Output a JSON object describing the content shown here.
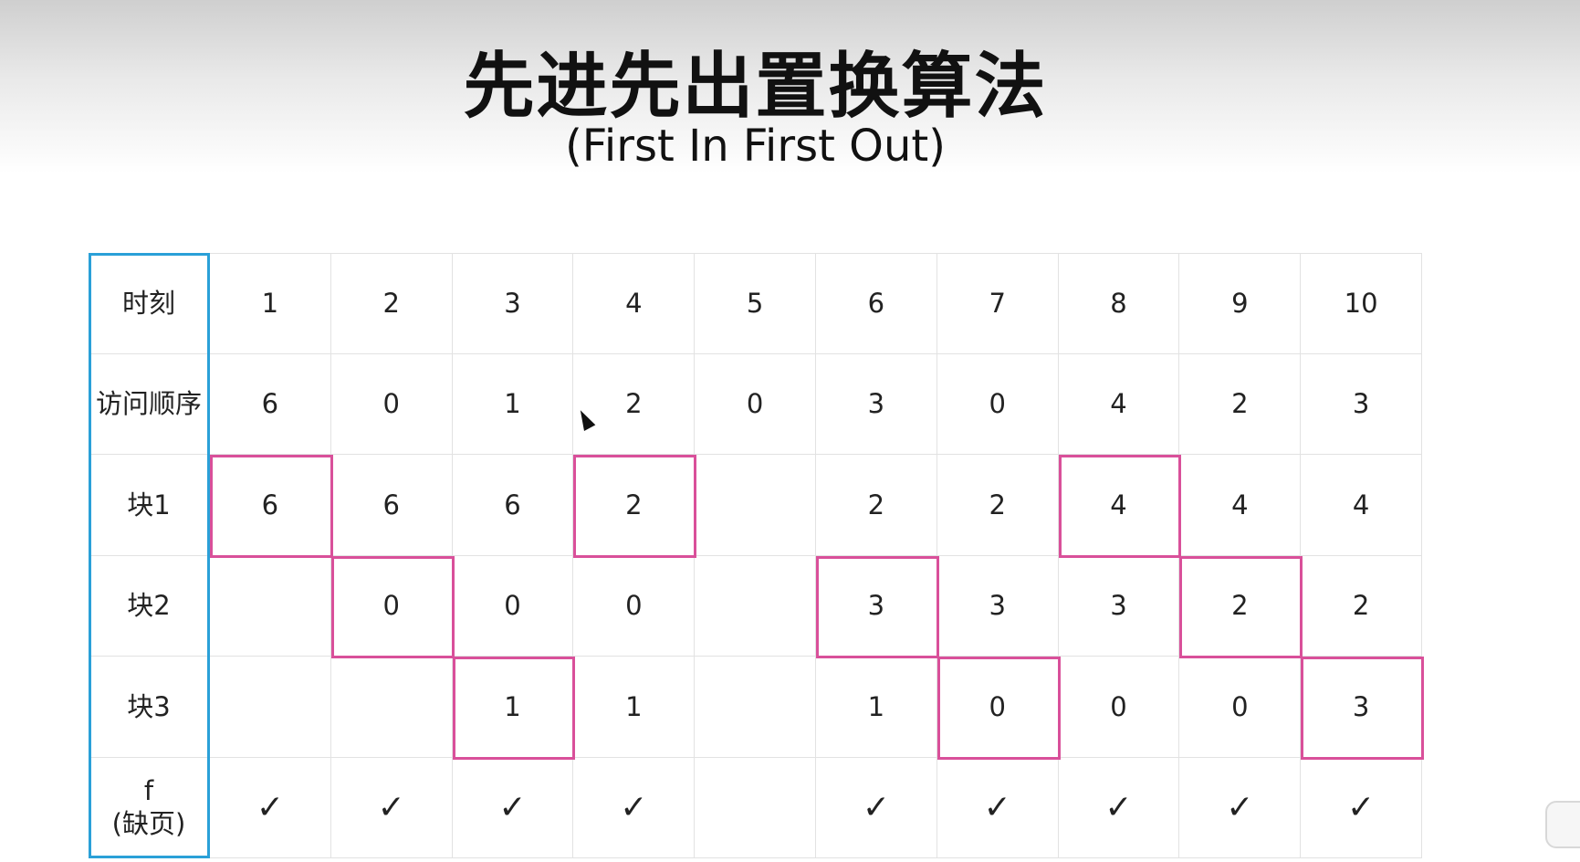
{
  "title": "先进先出置换算法",
  "subtitle": "(First In First Out)",
  "table": {
    "row_labels": [
      "时刻",
      "访问顺序",
      "块1",
      "块2",
      "块3",
      "f\n(缺页)"
    ],
    "times": [
      "1",
      "2",
      "3",
      "4",
      "5",
      "6",
      "7",
      "8",
      "9",
      "10"
    ],
    "access_sequence": [
      "6",
      "0",
      "1",
      "2",
      "0",
      "3",
      "0",
      "4",
      "2",
      "3"
    ],
    "block1": [
      "6",
      "6",
      "6",
      "2",
      "",
      "2",
      "2",
      "4",
      "4",
      "4"
    ],
    "block2": [
      "",
      "0",
      "0",
      "0",
      "",
      "3",
      "3",
      "3",
      "2",
      "2"
    ],
    "block3": [
      "",
      "",
      "1",
      "1",
      "",
      "1",
      "0",
      "0",
      "0",
      "3"
    ],
    "page_fault": [
      "✓",
      "✓",
      "✓",
      "✓",
      "",
      "✓",
      "✓",
      "✓",
      "✓",
      "✓"
    ]
  },
  "highlighted_cells": [
    {
      "block": 1,
      "time": 1
    },
    {
      "block": 2,
      "time": 2
    },
    {
      "block": 3,
      "time": 3
    },
    {
      "block": 1,
      "time": 4
    },
    {
      "block": 2,
      "time": 6
    },
    {
      "block": 3,
      "time": 7
    },
    {
      "block": 1,
      "time": 8
    },
    {
      "block": 2,
      "time": 9
    },
    {
      "block": 3,
      "time": 10
    }
  ],
  "colors": {
    "label_border": "#2aa0d8",
    "highlight_border": "#d9509a",
    "grid": "#e2e2e2"
  }
}
